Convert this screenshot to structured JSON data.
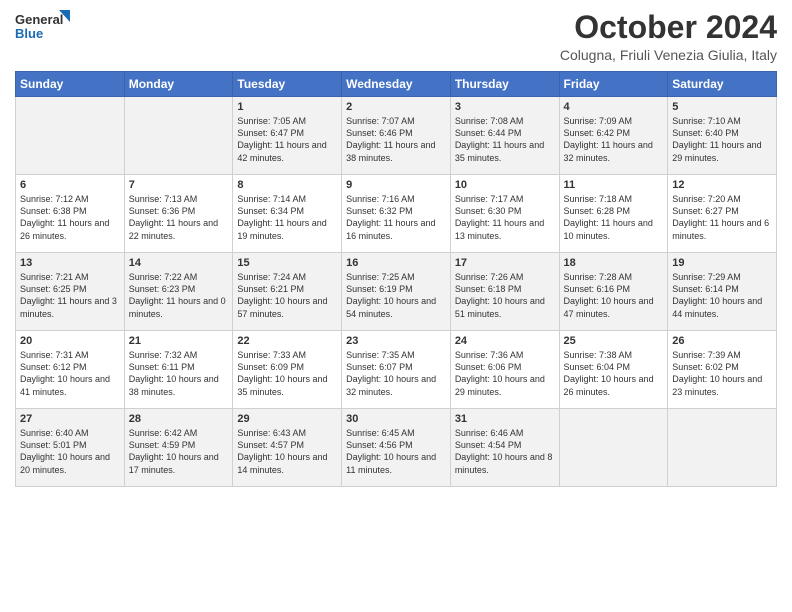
{
  "logo": {
    "line1": "General",
    "line2": "Blue"
  },
  "title": "October 2024",
  "location": "Colugna, Friuli Venezia Giulia, Italy",
  "days_of_week": [
    "Sunday",
    "Monday",
    "Tuesday",
    "Wednesday",
    "Thursday",
    "Friday",
    "Saturday"
  ],
  "weeks": [
    [
      {
        "day": "",
        "info": ""
      },
      {
        "day": "",
        "info": ""
      },
      {
        "day": "1",
        "info": "Sunrise: 7:05 AM\nSunset: 6:47 PM\nDaylight: 11 hours and 42 minutes."
      },
      {
        "day": "2",
        "info": "Sunrise: 7:07 AM\nSunset: 6:46 PM\nDaylight: 11 hours and 38 minutes."
      },
      {
        "day": "3",
        "info": "Sunrise: 7:08 AM\nSunset: 6:44 PM\nDaylight: 11 hours and 35 minutes."
      },
      {
        "day": "4",
        "info": "Sunrise: 7:09 AM\nSunset: 6:42 PM\nDaylight: 11 hours and 32 minutes."
      },
      {
        "day": "5",
        "info": "Sunrise: 7:10 AM\nSunset: 6:40 PM\nDaylight: 11 hours and 29 minutes."
      }
    ],
    [
      {
        "day": "6",
        "info": "Sunrise: 7:12 AM\nSunset: 6:38 PM\nDaylight: 11 hours and 26 minutes."
      },
      {
        "day": "7",
        "info": "Sunrise: 7:13 AM\nSunset: 6:36 PM\nDaylight: 11 hours and 22 minutes."
      },
      {
        "day": "8",
        "info": "Sunrise: 7:14 AM\nSunset: 6:34 PM\nDaylight: 11 hours and 19 minutes."
      },
      {
        "day": "9",
        "info": "Sunrise: 7:16 AM\nSunset: 6:32 PM\nDaylight: 11 hours and 16 minutes."
      },
      {
        "day": "10",
        "info": "Sunrise: 7:17 AM\nSunset: 6:30 PM\nDaylight: 11 hours and 13 minutes."
      },
      {
        "day": "11",
        "info": "Sunrise: 7:18 AM\nSunset: 6:28 PM\nDaylight: 11 hours and 10 minutes."
      },
      {
        "day": "12",
        "info": "Sunrise: 7:20 AM\nSunset: 6:27 PM\nDaylight: 11 hours and 6 minutes."
      }
    ],
    [
      {
        "day": "13",
        "info": "Sunrise: 7:21 AM\nSunset: 6:25 PM\nDaylight: 11 hours and 3 minutes."
      },
      {
        "day": "14",
        "info": "Sunrise: 7:22 AM\nSunset: 6:23 PM\nDaylight: 11 hours and 0 minutes."
      },
      {
        "day": "15",
        "info": "Sunrise: 7:24 AM\nSunset: 6:21 PM\nDaylight: 10 hours and 57 minutes."
      },
      {
        "day": "16",
        "info": "Sunrise: 7:25 AM\nSunset: 6:19 PM\nDaylight: 10 hours and 54 minutes."
      },
      {
        "day": "17",
        "info": "Sunrise: 7:26 AM\nSunset: 6:18 PM\nDaylight: 10 hours and 51 minutes."
      },
      {
        "day": "18",
        "info": "Sunrise: 7:28 AM\nSunset: 6:16 PM\nDaylight: 10 hours and 47 minutes."
      },
      {
        "day": "19",
        "info": "Sunrise: 7:29 AM\nSunset: 6:14 PM\nDaylight: 10 hours and 44 minutes."
      }
    ],
    [
      {
        "day": "20",
        "info": "Sunrise: 7:31 AM\nSunset: 6:12 PM\nDaylight: 10 hours and 41 minutes."
      },
      {
        "day": "21",
        "info": "Sunrise: 7:32 AM\nSunset: 6:11 PM\nDaylight: 10 hours and 38 minutes."
      },
      {
        "day": "22",
        "info": "Sunrise: 7:33 AM\nSunset: 6:09 PM\nDaylight: 10 hours and 35 minutes."
      },
      {
        "day": "23",
        "info": "Sunrise: 7:35 AM\nSunset: 6:07 PM\nDaylight: 10 hours and 32 minutes."
      },
      {
        "day": "24",
        "info": "Sunrise: 7:36 AM\nSunset: 6:06 PM\nDaylight: 10 hours and 29 minutes."
      },
      {
        "day": "25",
        "info": "Sunrise: 7:38 AM\nSunset: 6:04 PM\nDaylight: 10 hours and 26 minutes."
      },
      {
        "day": "26",
        "info": "Sunrise: 7:39 AM\nSunset: 6:02 PM\nDaylight: 10 hours and 23 minutes."
      }
    ],
    [
      {
        "day": "27",
        "info": "Sunrise: 6:40 AM\nSunset: 5:01 PM\nDaylight: 10 hours and 20 minutes."
      },
      {
        "day": "28",
        "info": "Sunrise: 6:42 AM\nSunset: 4:59 PM\nDaylight: 10 hours and 17 minutes."
      },
      {
        "day": "29",
        "info": "Sunrise: 6:43 AM\nSunset: 4:57 PM\nDaylight: 10 hours and 14 minutes."
      },
      {
        "day": "30",
        "info": "Sunrise: 6:45 AM\nSunset: 4:56 PM\nDaylight: 10 hours and 11 minutes."
      },
      {
        "day": "31",
        "info": "Sunrise: 6:46 AM\nSunset: 4:54 PM\nDaylight: 10 hours and 8 minutes."
      },
      {
        "day": "",
        "info": ""
      },
      {
        "day": "",
        "info": ""
      }
    ]
  ]
}
